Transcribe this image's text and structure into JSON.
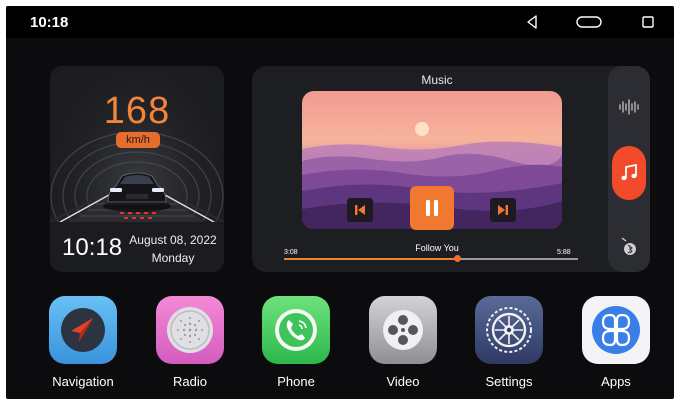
{
  "status_bar": {
    "time": "10:18",
    "nav_icons": [
      "back-icon",
      "home-icon",
      "recents-icon"
    ]
  },
  "dashboard": {
    "speed": "168",
    "speed_unit": "km/h",
    "time": "10:18",
    "date": "August 08, 2022",
    "weekday": "Monday"
  },
  "music": {
    "title": "Music",
    "song": "Follow You",
    "elapsed": "3:08",
    "duration": "5:88",
    "progress_fraction": 0.59,
    "controls": [
      "previous-icon",
      "pause-icon",
      "next-icon"
    ],
    "side_icons": [
      "equalizer-icon",
      "music-note-icon",
      "bluetooth-icon"
    ],
    "accent": "#f07830"
  },
  "apps": [
    {
      "label": "Navigation",
      "icon": "navigation-arrow-icon",
      "color": "#4aa8e8"
    },
    {
      "label": "Radio",
      "icon": "speaker-grille-icon",
      "color": "#e26cc8"
    },
    {
      "label": "Phone",
      "icon": "phone-handset-icon",
      "color": "#35c85a"
    },
    {
      "label": "Video",
      "icon": "film-reel-icon",
      "color": "#9c9c9c"
    },
    {
      "label": "Settings",
      "icon": "gear-icon",
      "color": "#3a4a78"
    },
    {
      "label": "Apps",
      "icon": "four-petal-grid-icon",
      "color": "#3a7ee8"
    }
  ]
}
